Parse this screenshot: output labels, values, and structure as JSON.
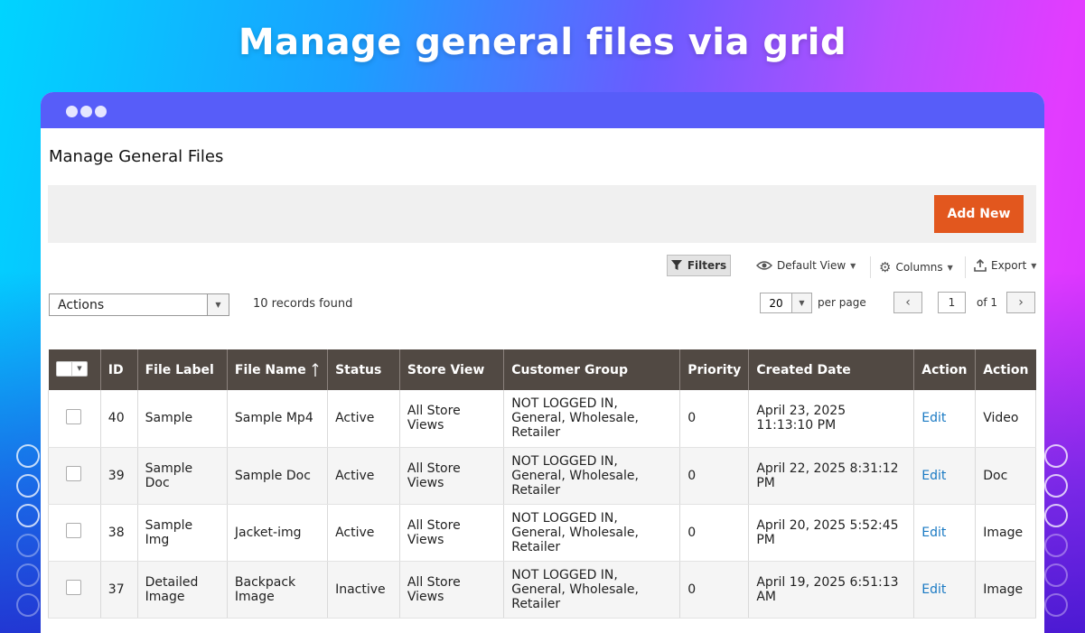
{
  "headline": "Manage general files via grid",
  "colors": {
    "accent": "#e2571e",
    "titlebar": "#575df9",
    "grid_header": "#514943",
    "link": "#1979c3"
  },
  "page": {
    "title": "Manage General Files"
  },
  "toolbar": {
    "add_new": "Add New",
    "filters": "Filters",
    "default_view": "Default View",
    "columns": "Columns",
    "export": "Export"
  },
  "massaction": {
    "label": "Actions"
  },
  "records_found": "10 records found",
  "pagination": {
    "per_page_value": "20",
    "per_page_label": "per page",
    "current_page": "1",
    "of_label": "of 1"
  },
  "grid": {
    "columns": [
      "ID",
      "File Label",
      "File Name",
      "Status",
      "Store View",
      "Customer Group",
      "Priority",
      "Created Date",
      "Action",
      "Action"
    ],
    "rows": [
      {
        "id": "40",
        "label": "Sample",
        "file_name": "Sample Mp4",
        "status": "Active",
        "store_view": "All Store Views",
        "customer_group": "NOT LOGGED IN, General, Wholesale, Retailer",
        "priority": "0",
        "created": "April 23, 2025 11:13:10 PM",
        "action": "Edit",
        "type": "Video"
      },
      {
        "id": "39",
        "label": "Sample Doc",
        "file_name": "Sample Doc",
        "status": "Active",
        "store_view": "All Store Views",
        "customer_group": "NOT LOGGED IN, General, Wholesale, Retailer",
        "priority": "0",
        "created": "April 22, 2025 8:31:12 PM",
        "action": "Edit",
        "type": "Doc"
      },
      {
        "id": "38",
        "label": "Sample Img",
        "file_name": "Jacket-img",
        "status": "Active",
        "store_view": "All Store Views",
        "customer_group": "NOT LOGGED IN, General, Wholesale, Retailer",
        "priority": "0",
        "created": "April 20, 2025 5:52:45 PM",
        "action": "Edit",
        "type": "Image"
      },
      {
        "id": "37",
        "label": "Detailed Image",
        "file_name": "Backpack Image",
        "status": "Inactive",
        "store_view": "All Store Views",
        "customer_group": "NOT LOGGED IN, General, Wholesale, Retailer",
        "priority": "0",
        "created": "April 19, 2025 6:51:13 AM",
        "action": "Edit",
        "type": "Image"
      }
    ]
  }
}
